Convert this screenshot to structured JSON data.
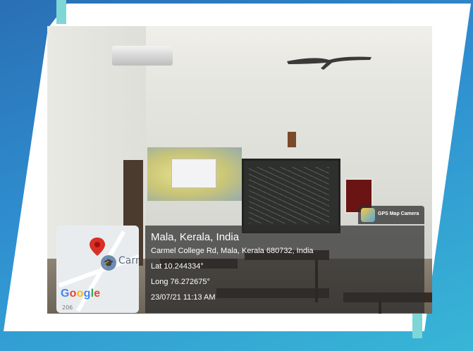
{
  "location": {
    "title": "Mala, Kerala, India",
    "address": "Carmel College Rd, Mala, Kerala 680732, India",
    "latitude": "Lat 10.244334°",
    "longitude": "Long 76.272675°",
    "datetime": "23/07/21 11:13 AM"
  },
  "map": {
    "place_label": "Carm",
    "logo": "Google",
    "corner_number": "206",
    "pin_color": "#d93025"
  },
  "badge": {
    "label": "GPS Map Camera",
    "icon": "gps-map-camera-icon"
  },
  "colors": {
    "frame_blue": "#2f8fd0",
    "accent_teal": "#7fd6d6"
  }
}
